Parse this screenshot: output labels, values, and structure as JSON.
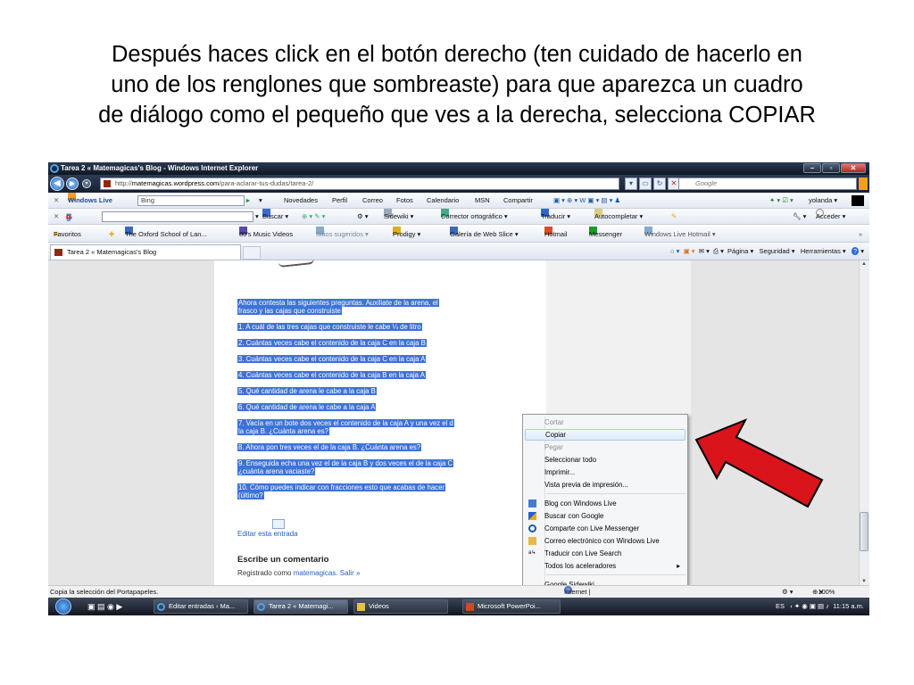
{
  "caption": [
    "Después haces click en el botón derecho (ten cuidado de hacerlo en",
    "uno de los renglones que sombreaste) para que aparezca un cuadro",
    "de diálogo como el pequeño que ves a la derecha, selecciona COPIAR"
  ],
  "window": {
    "title": "Tarea 2 « Matemagicas's Blog - Windows Internet Explorer"
  },
  "address": {
    "url_prefix": "http://",
    "url_domain": "matemagicas.wordpress.com",
    "url_path": "/para-aclarar-tus-dudas/tarea-2/",
    "search_placeholder": "Google"
  },
  "toolbar_wl": {
    "brand": "Windows Live",
    "search_value": "Bing",
    "links": [
      "Novedades",
      "Perfil",
      "Correo",
      "Fotos",
      "Calendario",
      "MSN",
      "Compartir"
    ],
    "user": "yolanda ▾"
  },
  "toolbar_google": {
    "search": "Buscar ▾",
    "sidewiki": "Sidewiki ▾",
    "spell": "Corrector ortográfico ▾",
    "translate": "Traducir ▾",
    "autofill": "Autocompletar ▾",
    "signin": "Acceder ▾"
  },
  "favorites": {
    "label": "Favoritos",
    "items": [
      "The Oxford School of Lan...",
      "80's Music Videos",
      "Sitios sugeridos ▾",
      "Prodigy ▾",
      "Galería de Web Slice ▾",
      "Hotmail",
      "Messenger",
      "Windows Live Hotmail ▾"
    ]
  },
  "tab": {
    "label": "Tarea 2 « Matemagicas's Blog",
    "commands": [
      "Página ▾",
      "Seguridad ▾",
      "Herramientas ▾"
    ]
  },
  "content": {
    "lines": [
      "Ahora contesta las siguientes preguntas. Auxiliate de la arena, el",
      "frasco y las cajas que construiste",
      "1. A cuál de las tres cajas que construiste le cabe ¼ de litro",
      "2. Cuántas veces cabe el contenido de la caja C en la caja B",
      "3. Cuántas veces cabe el contenido de la caja C en la caja A",
      "4. Cuántas veces cabe el contenido de la caja B en la caja A",
      "5. Qué cantidad de arena le cabe a la caja B",
      "6. Qué cantidad de arena le cabe a la caja A",
      "7. Vacía en un bote dos veces el contenido de la caja A y una vez el d",
      "la caja B. ¿Cuánta arena es?",
      "8. Ahora pon tres veces el de la caja B. ¿Cuánta arena es?",
      "9. Enseguida echa una vez el de la caja B y dos veces el de la caja C",
      "¿cuánta arena vaciaste?",
      "10. Cómo puedes indicar con fracciones esto que acabas de hacer",
      "(último?"
    ],
    "edit_link": "Editar esta entrada",
    "comment_heading": "Escribe un comentario",
    "registered_prefix": "Registrado como ",
    "registered_user": "matemagicas",
    "logout": ". Salir »"
  },
  "context_menu": {
    "items": [
      {
        "label": "Cortar",
        "disabled": true
      },
      {
        "label": "Copiar",
        "selected": true
      },
      {
        "label": "Pegar",
        "disabled": true
      },
      {
        "label": "Seleccionar todo"
      },
      {
        "label": "Imprimir..."
      },
      {
        "label": "Vista previa de impresión..."
      },
      {
        "label": "Blog con Windows Live"
      },
      {
        "label": "Buscar con Google"
      },
      {
        "label": "Comparte con Live Messenger"
      },
      {
        "label": "Correo electrónico con Windows Live"
      },
      {
        "label": "Traducir con Live Search"
      },
      {
        "label": "Todos los aceleradores"
      },
      {
        "label": "Google Sidewiki..."
      }
    ]
  },
  "status": {
    "left": "Copia la selección del Portapapeles.",
    "zone": "Internet | Modo protegido: activado",
    "zoom": "100%"
  },
  "taskbar": {
    "tasks": [
      "Editar entradas ‹ Ma...",
      "Tarea 2 « Matemagi...",
      "Videos",
      "Microsoft PowerPoi..."
    ],
    "lang": "ES",
    "clock": "11:15 a.m."
  },
  "colors": {
    "selection": "#3b73d8",
    "arrow": "#d9141b",
    "link": "#2460c0"
  }
}
